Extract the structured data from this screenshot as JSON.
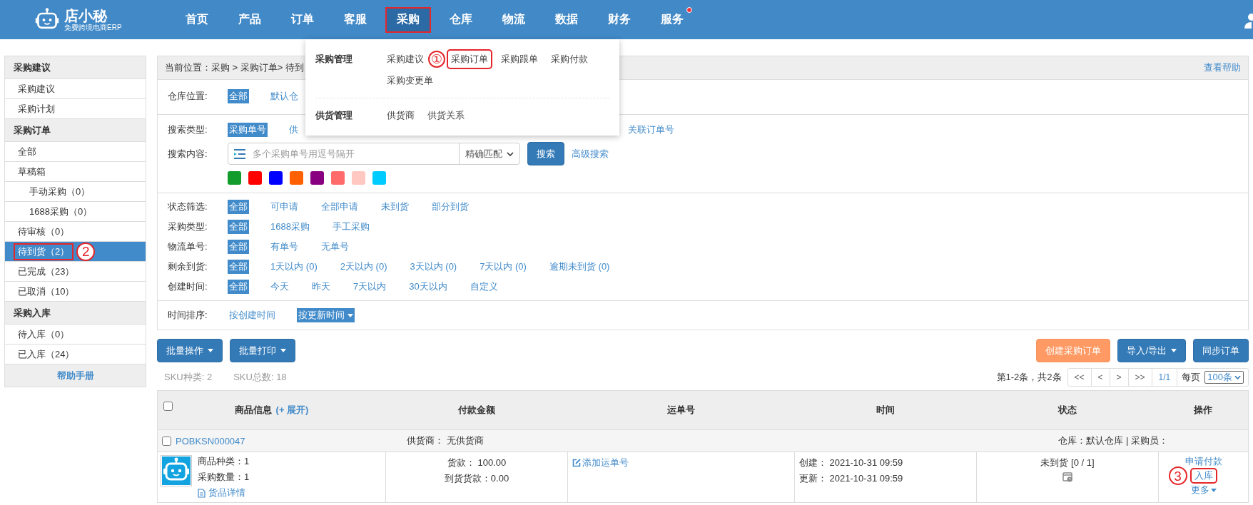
{
  "logo": {
    "name": "店小秘",
    "tagline": "免费跨境电商ERP"
  },
  "nav": [
    {
      "label": "首页",
      "selected": false,
      "boxed": false,
      "dot": false
    },
    {
      "label": "产品",
      "selected": false,
      "boxed": false,
      "dot": false
    },
    {
      "label": "订单",
      "selected": false,
      "boxed": false,
      "dot": false
    },
    {
      "label": "客服",
      "selected": false,
      "boxed": false,
      "dot": false
    },
    {
      "label": "采购",
      "selected": true,
      "boxed": true,
      "dot": false
    },
    {
      "label": "仓库",
      "selected": false,
      "boxed": false,
      "dot": false
    },
    {
      "label": "物流",
      "selected": false,
      "boxed": false,
      "dot": false
    },
    {
      "label": "数据",
      "selected": false,
      "boxed": false,
      "dot": false
    },
    {
      "label": "财务",
      "selected": false,
      "boxed": false,
      "dot": false
    },
    {
      "label": "服务",
      "selected": false,
      "boxed": false,
      "dot": true
    }
  ],
  "dropdown": {
    "groups": [
      {
        "title": "采购管理",
        "items": [
          {
            "label": "采购建议",
            "boxed": false
          },
          {
            "label": "①",
            "kind": "marker"
          },
          {
            "label": "采购订单",
            "boxed": true
          },
          {
            "label": "采购跟单",
            "boxed": false
          },
          {
            "label": "采购付款",
            "boxed": false
          },
          {
            "label": "采购变更单",
            "boxed": false
          }
        ]
      },
      {
        "title": "供货管理",
        "items": [
          {
            "label": "供货商",
            "boxed": false
          },
          {
            "label": "供货关系",
            "boxed": false
          }
        ]
      }
    ]
  },
  "sidebar": {
    "sections": [
      {
        "title": "采购建议",
        "items": [
          {
            "label": "采购建议",
            "selected": false,
            "boxed": false
          },
          {
            "label": "采购计划",
            "selected": false,
            "boxed": false
          }
        ]
      },
      {
        "title": "采购订单",
        "items": [
          {
            "label": "全部",
            "selected": false,
            "boxed": false
          },
          {
            "label": "草稿箱",
            "selected": false,
            "boxed": false,
            "children": [
              {
                "label": "手动采购（0）",
                "selected": false,
                "boxed": false
              },
              {
                "label": "1688采购（0）",
                "selected": false,
                "boxed": false
              }
            ]
          },
          {
            "label": "待审核（0）",
            "selected": false,
            "boxed": false
          },
          {
            "label": "待到货（2）",
            "selected": true,
            "boxed": true,
            "marker": "2"
          },
          {
            "label": "已完成（23）",
            "selected": false,
            "boxed": false
          },
          {
            "label": "已取消（10）",
            "selected": false,
            "boxed": false
          }
        ]
      },
      {
        "title": "采购入库",
        "items": [
          {
            "label": "待入库（0）",
            "selected": false,
            "boxed": false
          },
          {
            "label": "已入库（24）",
            "selected": false,
            "boxed": false
          }
        ]
      }
    ],
    "footer": "帮助手册"
  },
  "breadcrumb": "当前位置：采购 > 采购订单> 待到",
  "help_link": "查看帮助",
  "warehouse": {
    "label": "仓库位置:",
    "options": [
      {
        "label": "全部",
        "selected": true
      },
      {
        "label": "默认仓",
        "selected": false
      }
    ]
  },
  "search_type": {
    "label": "搜索类型:",
    "options": [
      {
        "label": "采购单号",
        "selected": true
      },
      {
        "label": "供",
        "selected": false
      },
      {
        "label": "关联订单号",
        "selected": false
      }
    ]
  },
  "search": {
    "label": "搜索内容:",
    "placeholder": "多个采购单号用逗号隔开",
    "match": "精确匹配",
    "button": "搜索",
    "advanced": "高级搜索"
  },
  "color_tags": [
    {
      "color": "#119c2b"
    },
    {
      "color": "#ff0000"
    },
    {
      "color": "#0000ff"
    },
    {
      "color": "#ff6000"
    },
    {
      "color": "#880080"
    },
    {
      "color": "#ff6b6b"
    },
    {
      "color": "#ffc8c0"
    },
    {
      "color": "#00ccff"
    }
  ],
  "filters": [
    {
      "label": "状态筛选:",
      "options": [
        {
          "label": "全部",
          "selected": true
        },
        {
          "label": "可申请",
          "selected": false
        },
        {
          "label": "全部申请",
          "selected": false
        },
        {
          "label": "未到货",
          "selected": false
        },
        {
          "label": "部分到货",
          "selected": false
        }
      ]
    },
    {
      "label": "采购类型:",
      "options": [
        {
          "label": "全部",
          "selected": true
        },
        {
          "label": "1688采购",
          "selected": false
        },
        {
          "label": "手工采购",
          "selected": false
        }
      ]
    },
    {
      "label": "物流单号:",
      "options": [
        {
          "label": "全部",
          "selected": true
        },
        {
          "label": "有单号",
          "selected": false
        },
        {
          "label": "无单号",
          "selected": false
        }
      ]
    },
    {
      "label": "剩余到货:",
      "options": [
        {
          "label": "全部",
          "selected": true
        },
        {
          "label": "1天以内 (0)",
          "selected": false
        },
        {
          "label": "2天以内 (0)",
          "selected": false
        },
        {
          "label": "3天以内 (0)",
          "selected": false
        },
        {
          "label": "7天以内 (0)",
          "selected": false
        },
        {
          "label": "逾期未到货 (0)",
          "selected": false
        }
      ]
    },
    {
      "label": "创建时间:",
      "options": [
        {
          "label": "全部",
          "selected": true
        },
        {
          "label": "今天",
          "selected": false
        },
        {
          "label": "昨天",
          "selected": false
        },
        {
          "label": "7天以内",
          "selected": false
        },
        {
          "label": "30天以内",
          "selected": false
        },
        {
          "label": "自定义",
          "selected": false
        }
      ]
    }
  ],
  "sort": {
    "label": "时间排序:",
    "options": [
      {
        "label": "按创建时间",
        "selected": false
      },
      {
        "label": "按更新时间",
        "selected": true
      }
    ]
  },
  "toolbar_left": [
    {
      "label": "批量操作",
      "kind": "primary",
      "caret": true
    },
    {
      "label": "批量打印",
      "kind": "primary",
      "caret": true
    }
  ],
  "toolbar_right": [
    {
      "label": "创建采购订单",
      "kind": "accent",
      "caret": false
    },
    {
      "label": "导入/导出",
      "kind": "primary",
      "caret": true
    },
    {
      "label": "同步订单",
      "kind": "primary",
      "caret": false
    }
  ],
  "stats": [
    "SKU种类: 2",
    "SKU总数: 18"
  ],
  "pagination": {
    "summary": "第1-2条，共2条",
    "buttons": [
      "<<",
      "<",
      ">",
      ">>"
    ],
    "page": "1/1",
    "per_page_label": "每页",
    "per_page": "100条"
  },
  "columns": [
    {
      "label": "商品信息",
      "extra": "(+ 展开)",
      "checked": false
    },
    {
      "label": "付款金额"
    },
    {
      "label": "运单号"
    },
    {
      "label": "时间"
    },
    {
      "label": "状态"
    },
    {
      "label": "操作"
    }
  ],
  "order": {
    "checked": false,
    "number": "POBKSN000047",
    "supplier": "供货商：  无供货商",
    "warehouse": "仓库：默认仓库 | 采购员：",
    "product_lines": [
      "商品种类：1",
      "采购数量：1"
    ],
    "detail_link": "货品详情",
    "payment": [
      "货款：  100.00",
      "到货货款：0.00"
    ],
    "tracking_link": "添加运单号",
    "times": [
      "创建：  2021-10-31 09:59",
      "更新：  2021-10-31 09:59"
    ],
    "status": "未到货 [0 / 1]",
    "actions": [
      {
        "label": "申请付款",
        "boxed": false,
        "caret": false
      },
      {
        "label": "入库",
        "boxed": true,
        "caret": false,
        "marker": "3"
      },
      {
        "label": "更多",
        "boxed": false,
        "caret": true
      }
    ]
  }
}
